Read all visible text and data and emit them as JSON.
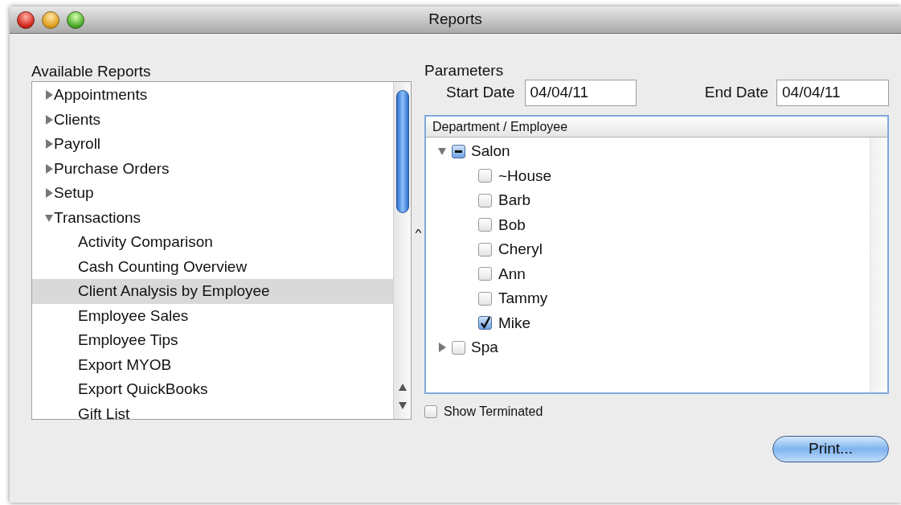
{
  "window": {
    "title": "Reports"
  },
  "available_reports": {
    "label": "Available Reports",
    "items": [
      {
        "label": "Appointments",
        "expanded": false,
        "selected": false
      },
      {
        "label": "Clients",
        "expanded": false,
        "selected": false
      },
      {
        "label": "Payroll",
        "expanded": false,
        "selected": false
      },
      {
        "label": "Purchase Orders",
        "expanded": false,
        "selected": false
      },
      {
        "label": "Setup",
        "expanded": false,
        "selected": false
      },
      {
        "label": "Transactions",
        "expanded": true,
        "selected": false,
        "children": [
          {
            "label": "Activity Comparison",
            "selected": false
          },
          {
            "label": "Cash Counting Overview",
            "selected": false
          },
          {
            "label": "Client Analysis by Employee",
            "selected": true
          },
          {
            "label": "Employee Sales",
            "selected": false
          },
          {
            "label": "Employee Tips",
            "selected": false
          },
          {
            "label": "Export MYOB",
            "selected": false
          },
          {
            "label": "Export QuickBooks",
            "selected": false
          },
          {
            "label": "Gift List",
            "selected": false
          }
        ]
      }
    ]
  },
  "parameters": {
    "label": "Parameters",
    "start_date": {
      "label": "Start Date",
      "value": "04/04/11"
    },
    "end_date": {
      "label": "End Date",
      "value": "04/04/11"
    },
    "tree": {
      "header": "Department / Employee",
      "departments": [
        {
          "name": "Salon",
          "expanded": true,
          "checked": false,
          "mixed": true,
          "employees": [
            {
              "name": "~House",
              "checked": false
            },
            {
              "name": "Barb",
              "checked": false
            },
            {
              "name": "Bob",
              "checked": false
            },
            {
              "name": "Cheryl",
              "checked": false
            },
            {
              "name": "Ann",
              "checked": false
            },
            {
              "name": "Tammy",
              "checked": false
            },
            {
              "name": "Mike",
              "checked": true
            }
          ]
        },
        {
          "name": "Spa",
          "expanded": false,
          "checked": false,
          "mixed": false
        }
      ]
    },
    "show_terminated": {
      "label": "Show Terminated",
      "checked": false
    }
  },
  "print_button": "Print..."
}
